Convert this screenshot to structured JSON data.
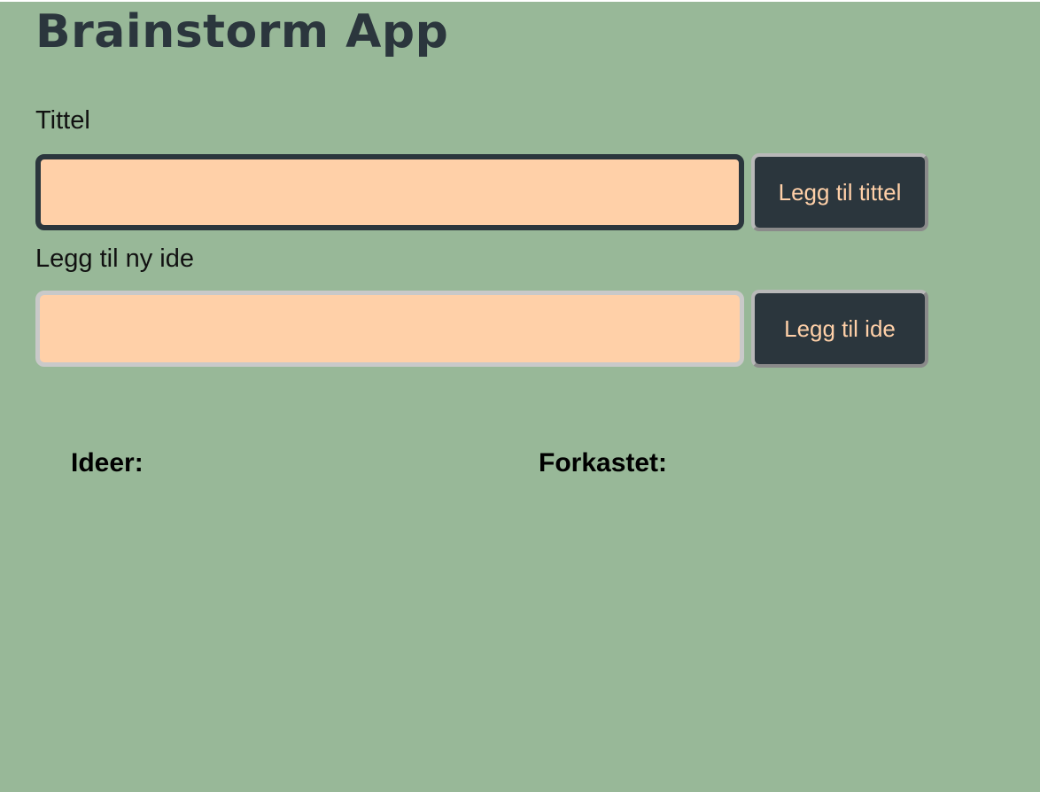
{
  "app": {
    "title": "Brainstorm App"
  },
  "title_form": {
    "label": "Tittel",
    "value": "",
    "button_label": "Legg til tittel"
  },
  "idea_form": {
    "label": "Legg til ny ide",
    "value": "",
    "button_label": "Legg til ide"
  },
  "lists": {
    "ideas_heading": "Ideer:",
    "discarded_heading": "Forkastet:"
  },
  "colors": {
    "background": "#98b898",
    "dark": "#2b363d",
    "input_fill": "#ffd0a8",
    "button_text": "#ffd0a8"
  }
}
